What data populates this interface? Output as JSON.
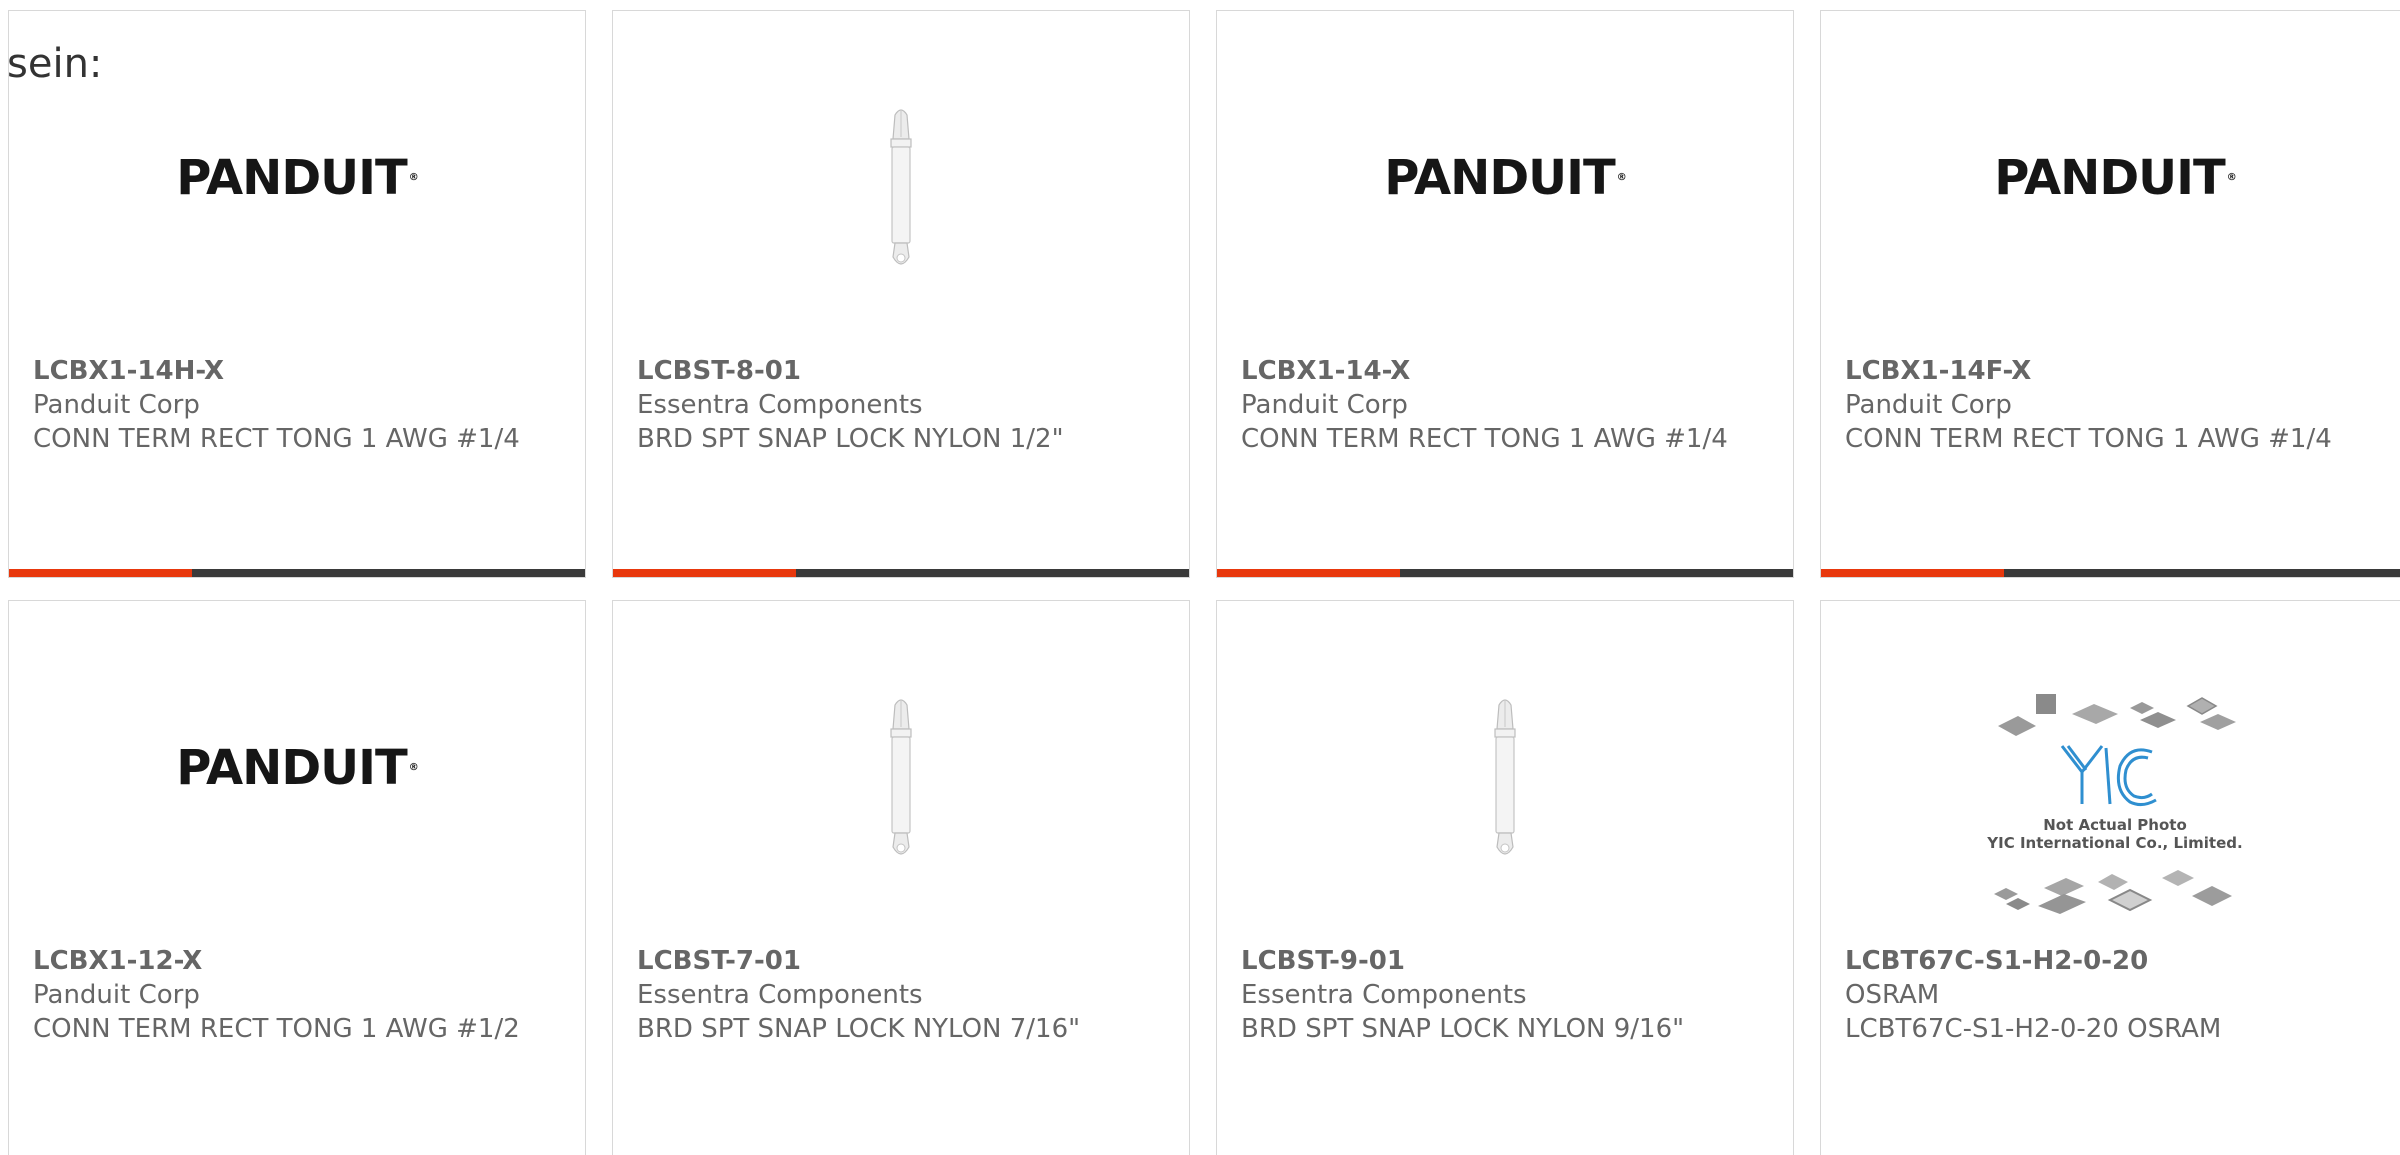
{
  "intro_text": "sein:",
  "brand_logo_text": "PANDUIT",
  "placeholder_photo": {
    "line1": "Not Actual Photo",
    "line2": "YIC International Co., Limited."
  },
  "colors": {
    "accent_red": "#e8380d",
    "accent_dark": "#3a3a3a",
    "text": "#666666"
  },
  "products": [
    {
      "part": "LCBX1-14H-X",
      "manufacturer": "Panduit Corp",
      "description": "CONN TERM RECT TONG 1 AWG #1/4",
      "image": "panduit-logo"
    },
    {
      "part": "LCBST-8-01",
      "manufacturer": "Essentra Components",
      "description": "BRD SPT SNAP LOCK NYLON 1/2\"",
      "image": "standoff-photo"
    },
    {
      "part": "LCBX1-14-X",
      "manufacturer": "Panduit Corp",
      "description": "CONN TERM RECT TONG 1 AWG #1/4",
      "image": "panduit-logo"
    },
    {
      "part": "LCBX1-14F-X",
      "manufacturer": "Panduit Corp",
      "description": "CONN TERM RECT TONG 1 AWG #1/4",
      "image": "panduit-logo"
    },
    {
      "part": "LCBX1-12-X",
      "manufacturer": "Panduit Corp",
      "description": "CONN TERM RECT TONG 1 AWG #1/2",
      "image": "panduit-logo"
    },
    {
      "part": "LCBST-7-01",
      "manufacturer": "Essentra Components",
      "description": "BRD SPT SNAP LOCK NYLON 7/16\"",
      "image": "standoff-photo"
    },
    {
      "part": "LCBST-9-01",
      "manufacturer": "Essentra Components",
      "description": "BRD SPT SNAP LOCK NYLON 9/16\"",
      "image": "standoff-photo"
    },
    {
      "part": "LCBT67C-S1-H2-0-20",
      "manufacturer": "OSRAM",
      "description": "LCBT67C-S1-H2-0-20 OSRAM",
      "image": "yic-placeholder"
    }
  ]
}
